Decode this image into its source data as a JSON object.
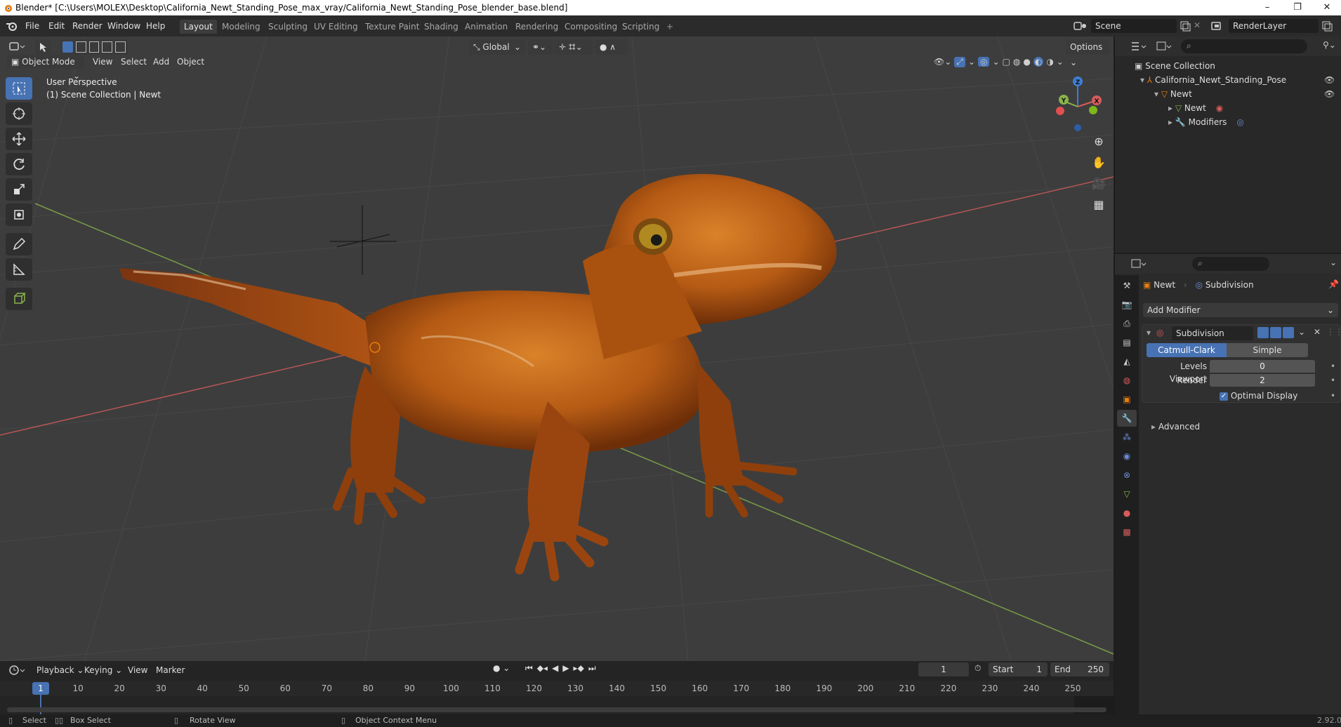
{
  "window": {
    "title": "Blender* [C:\\Users\\MOLEX\\Desktop\\California_Newt_Standing_Pose_max_vray/California_Newt_Standing_Pose_blender_base.blend]",
    "minimize": "–",
    "restore": "❐",
    "close": "✕"
  },
  "topbar": {
    "menus": [
      "File",
      "Edit",
      "Render",
      "Window",
      "Help"
    ],
    "workspaces": [
      "Layout",
      "Modeling",
      "Sculpting",
      "UV Editing",
      "Texture Paint",
      "Shading",
      "Animation",
      "Rendering",
      "Compositing",
      "Scripting"
    ],
    "add_workspace": "+",
    "scene": "Scene",
    "render_layer": "RenderLayer"
  },
  "viewport_header": {
    "mode": "Object Mode",
    "menus": [
      "View",
      "Select",
      "Add",
      "Object"
    ],
    "orientation": "Global",
    "options": "Options"
  },
  "viewport": {
    "overlay_line1": "User Perspective",
    "overlay_line2": "(1) Scene Collection | Newt",
    "gizmo_x": "X",
    "gizmo_y": "Y",
    "gizmo_z": "Z"
  },
  "outliner": {
    "root": "Scene Collection",
    "items": [
      {
        "label": "California_Newt_Standing_Pose"
      },
      {
        "label": "Newt"
      },
      {
        "label": "Newt"
      },
      {
        "label": "Modifiers"
      }
    ]
  },
  "properties": {
    "object_name": "Newt",
    "modifier_breadcrumb": "Subdivision",
    "add_modifier": "Add Modifier",
    "modifier_name": "Subdivision",
    "type_catmull": "Catmull-Clark",
    "type_simple": "Simple",
    "levels_viewport_label": "Levels Viewport",
    "levels_viewport_value": "0",
    "render_label": "Render",
    "render_value": "2",
    "optimal_display": "Optimal Display",
    "advanced": "Advanced"
  },
  "timeline": {
    "menus": [
      "Playback",
      "Keying",
      "View",
      "Marker"
    ],
    "current_frame": "1",
    "start_label": "Start",
    "start_value": "1",
    "end_label": "End",
    "end_value": "250",
    "ruler": [
      "1",
      "10",
      "20",
      "30",
      "40",
      "50",
      "60",
      "70",
      "80",
      "90",
      "100",
      "110",
      "120",
      "130",
      "140",
      "150",
      "160",
      "170",
      "180",
      "190",
      "200",
      "210",
      "220",
      "230",
      "240",
      "250"
    ]
  },
  "statusbar": {
    "select": "Select",
    "box_select": "Box Select",
    "rotate_view": "Rotate View",
    "context_menu": "Object Context Menu",
    "version": "2.92.0"
  },
  "colors": {
    "accent": "#4772b3",
    "axis_x": "#d65c5c",
    "axis_y": "#8ab34a",
    "axis_z": "#3d7fd6",
    "newt": "#b45a14"
  }
}
